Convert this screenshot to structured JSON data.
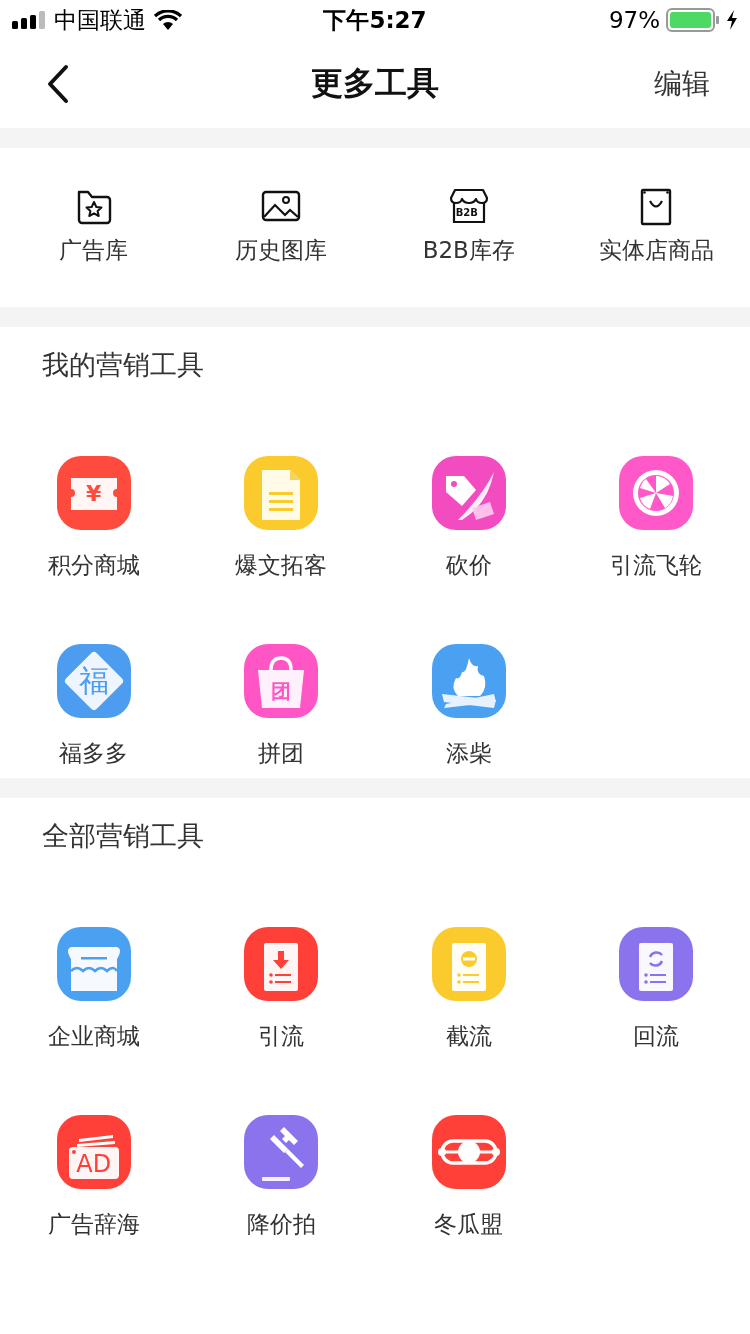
{
  "status_bar": {
    "carrier": "中国联通",
    "time": "下午5:27",
    "battery": "97%"
  },
  "nav": {
    "title": "更多工具",
    "action": "编辑"
  },
  "quick_tools": [
    {
      "label": "广告库",
      "kind": "folder-star"
    },
    {
      "label": "历史图库",
      "kind": "image"
    },
    {
      "label": "B2B库存",
      "kind": "store",
      "glyph": "B2B"
    },
    {
      "label": "实体店商品",
      "kind": "bag"
    }
  ],
  "sections": [
    {
      "title": "我的营销工具",
      "tools": [
        {
          "label": "积分商城",
          "kind": "coupon",
          "color": "#ff4b3e",
          "glyph": "¥"
        },
        {
          "label": "爆文拓客",
          "kind": "document",
          "color": "#fbcb2d"
        },
        {
          "label": "砍价",
          "kind": "tag",
          "color": "#f24cc0"
        },
        {
          "label": "引流飞轮",
          "kind": "wheel",
          "color": "#ff58c8"
        },
        {
          "label": "福多多",
          "kind": "diamond",
          "color": "#4c9df0",
          "glyph": "福"
        },
        {
          "label": "拼团",
          "kind": "bag",
          "color": "#ff55c5",
          "glyph": "团"
        },
        {
          "label": "添柴",
          "kind": "fire",
          "color": "#4ba1f1"
        }
      ]
    },
    {
      "title": "全部营销工具",
      "tools": [
        {
          "label": "企业商城",
          "kind": "store",
          "color": "#4ba1f1"
        },
        {
          "label": "引流",
          "kind": "download-doc",
          "color": "#ff4038"
        },
        {
          "label": "截流",
          "kind": "stop-doc",
          "color": "#fbcb2d"
        },
        {
          "label": "回流",
          "kind": "refresh-doc",
          "color": "#8a73ec"
        },
        {
          "label": "广告辞海",
          "kind": "ad-card",
          "color": "#ff4038",
          "glyph": "AD"
        },
        {
          "label": "降价拍",
          "kind": "gavel",
          "color": "#8a73ec"
        },
        {
          "label": "冬瓜盟",
          "kind": "band",
          "color": "#ff4038"
        }
      ]
    }
  ]
}
